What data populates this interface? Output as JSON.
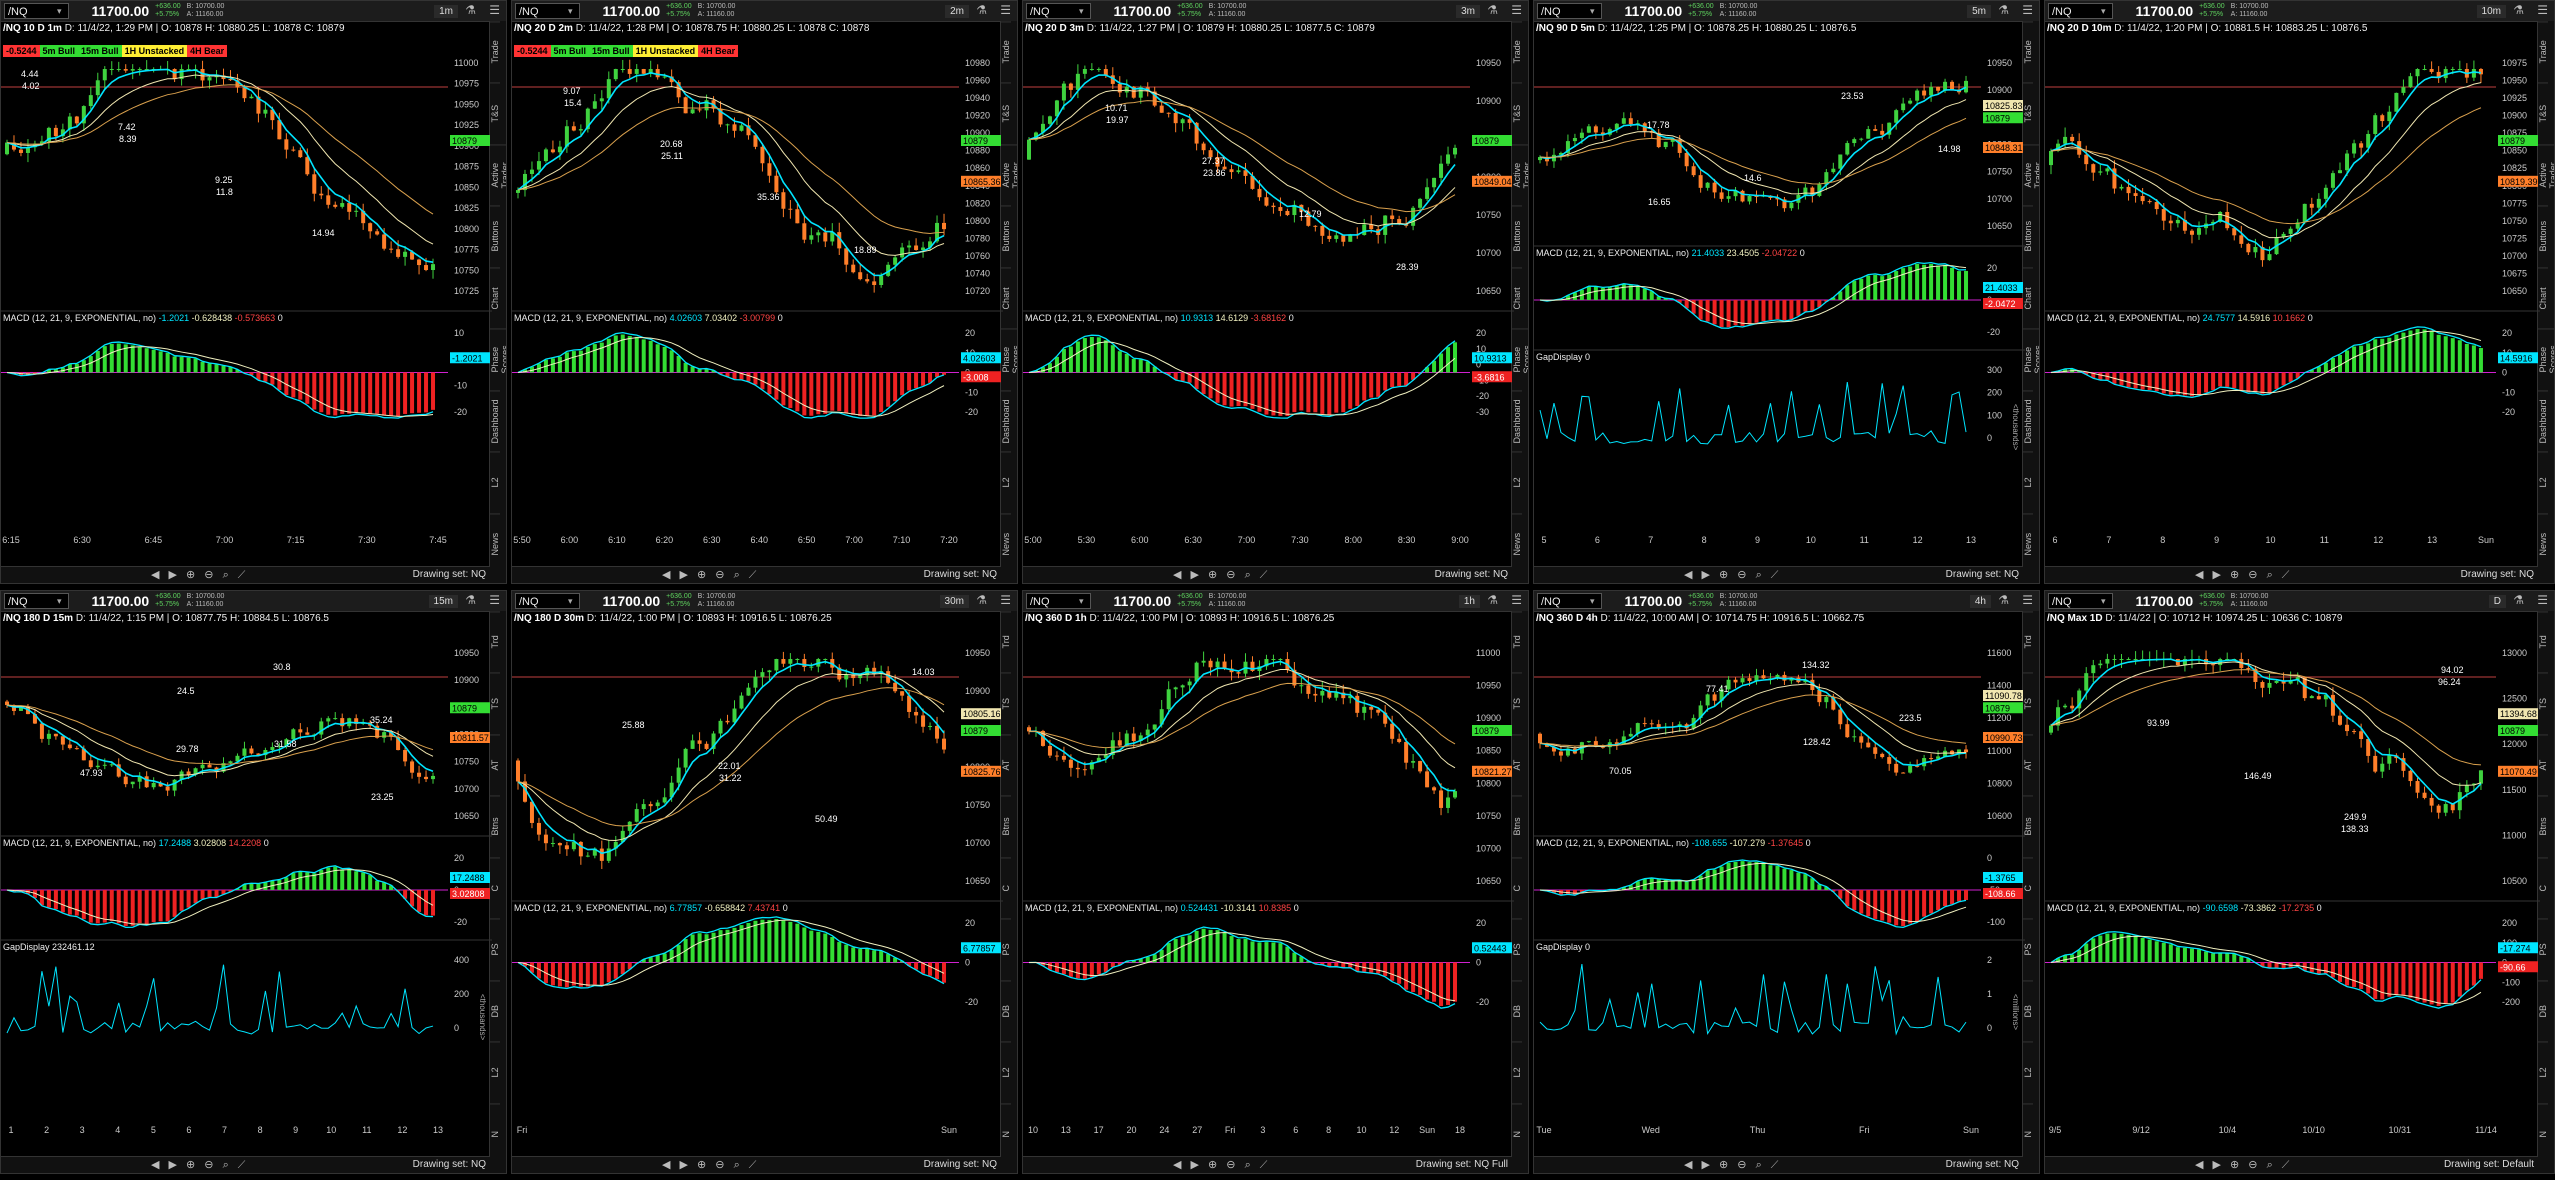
{
  "global": {
    "symbol": "/NQ",
    "last_price": "11700.00",
    "change_line1": "+636.00",
    "change_line2": "+5.75%",
    "bid": "B: 10700.00",
    "ask": "A: 11160.00",
    "drawing_set_default": "Drawing set: NQ",
    "drawing_set_full": "Drawing set: NQ Full",
    "drawing_set_def": "Drawing set: Default",
    "tools": "◀ ▶ ⊕ ⊖ ⌕ ⟋",
    "colors": {
      "up": "#3fd23f",
      "down": "#ff7f2a",
      "ema_fast": "#00e5ff",
      "ema_slow": "#d9a04d",
      "macd": "#00e5ff",
      "signal": "#f0f0c0"
    }
  },
  "panels": [
    {
      "timeframe": "1m",
      "title": "/NQ 10 D 1m",
      "header": "D: 11/4/22, 1:29 PM  | O: 10878  H: 10880.25  L: 10878  C: 10879",
      "labels": [
        {
          "t": "-0.5244",
          "c": "#ff3333"
        },
        {
          "t": "5m Bull",
          "c": "#33dd33"
        },
        {
          "t": "15m Bull",
          "c": "#33dd33"
        },
        {
          "t": "1H Unstacked",
          "c": "#ffee33"
        },
        {
          "t": "4H Bear",
          "c": "#ff3333"
        }
      ],
      "yticks": [
        "11000",
        "10975",
        "10950",
        "10925",
        "10900",
        "10875",
        "10850",
        "10825",
        "10800",
        "10775",
        "10750",
        "10725"
      ],
      "price_tag": "10879",
      "xticks": [
        "6:15",
        "6:30",
        "6:45",
        "7:00",
        "7:15",
        "7:30",
        "7:45"
      ],
      "macd": {
        "label": "MACD (12, 21, 9, EXPONENTIAL, no)",
        "v1": "-1.2021",
        "v2": "-0.628438",
        "v3": "-0.573663",
        "v4": "0"
      },
      "macd_ticks": [
        "10",
        "0",
        "-10",
        "-20"
      ],
      "macd_tag": "-1.2021",
      "tabs": [
        "Trade",
        "T&S",
        "Active Trader",
        "Buttons",
        "Chart",
        "Phase Scores",
        "Dashboard",
        "L2",
        "News"
      ],
      "annotations": [
        "4.44",
        "7.42",
        "9.25",
        "14.94",
        "4.02",
        "8.39",
        "11.8"
      ]
    },
    {
      "timeframe": "2m",
      "title": "/NQ 20 D 2m",
      "header": "D: 11/4/22, 1:28 PM  | O: 10878.75  H: 10880.25  L: 10878  C: 10878",
      "labels": [
        {
          "t": "-0.5244",
          "c": "#ff3333"
        },
        {
          "t": "5m Bull",
          "c": "#33dd33"
        },
        {
          "t": "15m Bull",
          "c": "#33dd33"
        },
        {
          "t": "1H Unstacked",
          "c": "#ffee33"
        },
        {
          "t": "4H Bear",
          "c": "#ff3333"
        }
      ],
      "yticks": [
        "10980",
        "10960",
        "10940",
        "10920",
        "10900",
        "10880",
        "10860",
        "10840",
        "10820",
        "10800",
        "10780",
        "10760",
        "10740",
        "10720"
      ],
      "price_tag": "10879",
      "price_tag2": "10865.36",
      "xticks": [
        "5:50",
        "6:00",
        "6:10",
        "6:20",
        "6:30",
        "6:40",
        "6:50",
        "7:00",
        "7:10",
        "7:20"
      ],
      "macd": {
        "label": "MACD (12, 21, 9, EXPONENTIAL, no)",
        "v1": "4.02603",
        "v2": "7.03402",
        "v3": "-3.00799",
        "v4": "0"
      },
      "macd_ticks": [
        "20",
        "10",
        "0",
        "-10",
        "-20"
      ],
      "macd_tag": "4.02603",
      "macd_tag2": "-3.008",
      "tabs": [
        "Trade",
        "T&S",
        "Active Trader",
        "Buttons",
        "Chart",
        "Phase Scores",
        "Dashboard",
        "L2",
        "News"
      ],
      "annotations": [
        "9.07",
        "20.68",
        "35.36",
        "18.89",
        "15.4",
        "25.11"
      ]
    },
    {
      "timeframe": "3m",
      "title": "/NQ 20 D 3m",
      "header": "D: 11/4/22, 1:27 PM  | O: 10879  H: 10880.25  L: 10877.5  C: 10879",
      "labels": [],
      "yticks": [
        "10950",
        "10900",
        "10850",
        "10800",
        "10750",
        "10700",
        "10650"
      ],
      "price_tag": "10879",
      "price_tag2": "10849.04",
      "xticks": [
        "5:00",
        "5:30",
        "6:00",
        "6:30",
        "7:00",
        "7:30",
        "8:00",
        "8:30",
        "9:00"
      ],
      "macd": {
        "label": "MACD (12, 21, 9, EXPONENTIAL, no)",
        "v1": "10.9313",
        "v2": "14.6129",
        "v3": "-3.68162",
        "v4": "0"
      },
      "macd_ticks": [
        "20",
        "10",
        "0",
        "-10",
        "-20",
        "-30"
      ],
      "macd_tag": "10.9313",
      "macd_tag2": "-3.6816",
      "tabs": [
        "Trade",
        "T&S",
        "Active Trader",
        "Buttons",
        "Chart",
        "Phase Scores",
        "Dashboard",
        "L2",
        "News"
      ],
      "annotations": [
        "10.71",
        "27.37",
        "12.79",
        "28.39",
        "19.97",
        "23.86"
      ]
    },
    {
      "timeframe": "5m",
      "title": "/NQ 90 D 5m",
      "header": "D: 11/4/22, 1:25 PM  | O: 10878.25  H: 10880.25  L: 10876.5",
      "labels": [],
      "yticks": [
        "10950",
        "10900",
        "10850",
        "10800",
        "10750",
        "10700",
        "10650"
      ],
      "price_tag": "10879",
      "price_tag2": "10848.31",
      "price_tag3": "10825.83",
      "xticks": [
        "5",
        "6",
        "7",
        "8",
        "9",
        "10",
        "11",
        "12",
        "13"
      ],
      "macd": {
        "label": "MACD (12, 21, 9, EXPONENTIAL, no)",
        "v1": "21.4033",
        "v2": "23.4505",
        "v3": "-2.04722",
        "v4": "0"
      },
      "macd_ticks": [
        "20",
        "0",
        "-20"
      ],
      "macd_tag": "21.4033",
      "macd_tag2": "-2.0472",
      "gap": {
        "label": "GapDisplay",
        "v": "0",
        "ticks": [
          "300",
          "200",
          "100",
          "0"
        ],
        "unit": "<thousands>"
      },
      "tabs": [
        "Trade",
        "T&S",
        "Active Trader",
        "Buttons",
        "Chart",
        "Phase Scores",
        "Dashboard",
        "L2",
        "News"
      ],
      "annotations": [
        "17.78",
        "14.6",
        "23.53",
        "14.98",
        "16.65"
      ]
    },
    {
      "timeframe": "10m",
      "title": "/NQ 20 D 10m",
      "header": "D: 11/4/22, 1:20 PM  | O: 10881.5  H: 10883.25  L: 10876.5",
      "labels": [],
      "yticks": [
        "10975",
        "10950",
        "10925",
        "10900",
        "10875",
        "10850",
        "10825",
        "10800",
        "10775",
        "10750",
        "10725",
        "10700",
        "10675",
        "10650"
      ],
      "price_tag": "10879",
      "price_tag2": "10819.39",
      "xticks": [
        "6",
        "7",
        "8",
        "9",
        "10",
        "11",
        "12",
        "13",
        "Sun"
      ],
      "macd": {
        "label": "MACD (12, 21, 9, EXPONENTIAL, no)",
        "v1": "24.7577",
        "v2": "14.5916",
        "v3": "10.1662",
        "v4": "0"
      },
      "macd_ticks": [
        "20",
        "10",
        "0",
        "-10",
        "-20"
      ],
      "macd_tag": "14.5916",
      "tabs": [
        "Trade",
        "T&S",
        "Active Trader",
        "Buttons",
        "Chart",
        "Phase Scores",
        "Dashboard",
        "L2",
        "News"
      ],
      "annotations": []
    },
    {
      "timeframe": "15m",
      "title": "/NQ 180 D 15m",
      "header": "D: 11/4/22, 1:15 PM  | O: 10877.75  H: 10884.5  L: 10876.5",
      "labels": [],
      "yticks": [
        "10950",
        "10900",
        "10850",
        "10800",
        "10750",
        "10700",
        "10650"
      ],
      "price_tag": "10879",
      "price_tag2": "10811.57",
      "xticks": [
        "1",
        "2",
        "3",
        "4",
        "5",
        "6",
        "7",
        "8",
        "9",
        "10",
        "11",
        "12",
        "13"
      ],
      "macd": {
        "label": "MACD (12, 21, 9, EXPONENTIAL, no)",
        "v1": "17.2488",
        "v2": "3.02808",
        "v3": "14.2208",
        "v4": "0"
      },
      "macd_ticks": [
        "20",
        "0",
        "-20"
      ],
      "macd_tag": "17.2488",
      "macd_tag2": "3.02808",
      "gap": {
        "label": "GapDisplay",
        "v": "232461.12",
        "ticks": [
          "400",
          "200",
          "0"
        ],
        "unit": "<thousands>"
      },
      "tabs": [
        "Trd",
        "TS",
        "AT",
        "Btns",
        "C",
        "PS",
        "DB",
        "L2",
        "N"
      ],
      "annotations": [
        "29.78",
        "30.8",
        "35.24",
        "47.93",
        "24.5",
        "31.58",
        "23.25"
      ]
    },
    {
      "timeframe": "30m",
      "title": "/NQ 180 D 30m",
      "header": "D: 11/4/22, 1:00 PM  | O: 10893  H: 10916.5  L: 10876.25",
      "labels": [],
      "yticks": [
        "10950",
        "10900",
        "10850",
        "10800",
        "10750",
        "10700",
        "10650"
      ],
      "price_tag": "10879",
      "price_tag2": "10825.76",
      "price_tag3": "10805.16",
      "xticks": [
        "Fri",
        "Sun"
      ],
      "macd": {
        "label": "MACD (12, 21, 9, EXPONENTIAL, no)",
        "v1": "6.77857",
        "v2": "-0.658842",
        "v3": "7.43741",
        "v4": "0"
      },
      "macd_ticks": [
        "20",
        "0",
        "-20"
      ],
      "macd_tag": "6.77857",
      "tabs": [
        "Trd",
        "TS",
        "AT",
        "Btns",
        "C",
        "PS",
        "DB",
        "L2",
        "N"
      ],
      "annotations": [
        "22.01",
        "50.49",
        "14.03",
        "25.88",
        "31.22"
      ]
    },
    {
      "timeframe": "1h",
      "title": "/NQ 360 D 1h",
      "header": "D: 11/4/22, 1:00 PM  | O: 10893  H: 10916.5  L: 10876.25",
      "labels": [],
      "yticks": [
        "11000",
        "10950",
        "10900",
        "10850",
        "10800",
        "10750",
        "10700",
        "10650"
      ],
      "price_tag": "10879",
      "price_tag2": "10821.27",
      "xticks": [
        "10",
        "13",
        "17",
        "20",
        "24",
        "27",
        "Fri",
        "3",
        "6",
        "8",
        "10",
        "12",
        "Sun",
        "18"
      ],
      "macd": {
        "label": "MACD (12, 21, 9, EXPONENTIAL, no)",
        "v1": "0.524431",
        "v2": "-10.3141",
        "v3": "10.8385",
        "v4": "0"
      },
      "macd_ticks": [
        "20",
        "0",
        "-20"
      ],
      "macd_tag": "0.52443",
      "tabs": [
        "Trd",
        "TS",
        "AT",
        "Btns",
        "C",
        "PS",
        "DB",
        "L2",
        "N"
      ],
      "annotations": []
    },
    {
      "timeframe": "4h",
      "title": "/NQ 360 D 4h",
      "header": "D: 11/4/22, 10:00 AM  | O: 10714.75  H: 10916.5  L: 10662.75",
      "labels": [],
      "yticks": [
        "11600",
        "11400",
        "11200",
        "11000",
        "10800",
        "10600"
      ],
      "price_tag": "10879",
      "price_tag2": "10990.73",
      "price_tag3": "11090.78",
      "xticks": [
        "Tue",
        "Wed",
        "Thu",
        "Fri",
        "Sun"
      ],
      "macd": {
        "label": "MACD (12, 21, 9, EXPONENTIAL, no)",
        "v1": "-108.655",
        "v2": "-107.279",
        "v3": "-1.37645",
        "v4": "0"
      },
      "macd_ticks": [
        "0",
        "-50",
        "-100"
      ],
      "macd_tag": "-1.3765",
      "macd_tag2": "-108.66",
      "gap": {
        "label": "GapDisplay",
        "v": "0",
        "ticks": [
          "2",
          "1",
          "0"
        ],
        "unit": "<millions>"
      },
      "tabs": [
        "Trd",
        "TS",
        "AT",
        "Btns",
        "C",
        "PS",
        "DB",
        "L2",
        "N"
      ],
      "annotations": [
        "134.32",
        "223.5",
        "70.05",
        "77.41",
        "128.42"
      ]
    },
    {
      "timeframe": "D",
      "title": "/NQ Max 1D",
      "header": "D: 11/4/22  | O: 10712  H: 10974.25  L: 10636  C: 10879",
      "labels": [],
      "yticks": [
        "13000",
        "12500",
        "12000",
        "11500",
        "11000",
        "10500"
      ],
      "price_tag": "10879",
      "price_tag2": "11070.49",
      "price_tag3": "11394.68",
      "xticks": [
        "9/5",
        "9/12",
        "10/4",
        "10/10",
        "10/31",
        "11/14"
      ],
      "macd": {
        "label": "MACD (12, 21, 9, EXPONENTIAL, no)",
        "v1": "-90.6598",
        "v2": "-73.3862",
        "v3": "-17.2735",
        "v4": "0"
      },
      "macd_ticks": [
        "200",
        "100",
        "0",
        "-100",
        "-200"
      ],
      "macd_tag": "-17.274",
      "macd_tag2": "-90.66",
      "tabs": [
        "Trd",
        "TS",
        "AT",
        "Btns",
        "C",
        "PS",
        "DB",
        "L2",
        "N"
      ],
      "annotations": [
        "249.9",
        "94.02",
        "93.99",
        "146.49",
        "138.33",
        "96.24"
      ]
    }
  ]
}
